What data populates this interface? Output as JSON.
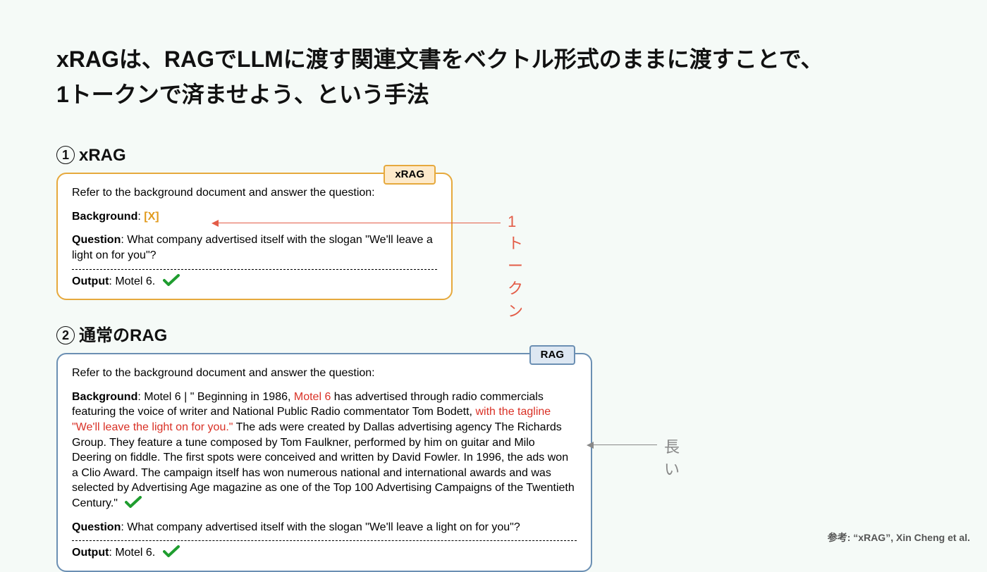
{
  "title_line1": "xRAGは、RAGでLLMに渡す関連文書をベクトル形式のままに渡すことで、",
  "title_line2": "1トークンで済ませよう、という手法",
  "section1": {
    "num": "1",
    "heading": "xRAG",
    "badge": "xRAG",
    "prompt": "Refer to the background document and answer the question:",
    "bg_label": "Background",
    "bg_token": "[X]",
    "q_label": "Question",
    "q_text": ": What company advertised itself with the slogan \"We'll leave a light on for you\"?",
    "out_label": "Output",
    "out_text": ": Motel 6.",
    "annotation": "1トークン"
  },
  "section2": {
    "num": "2",
    "heading": "通常のRAG",
    "badge": "RAG",
    "prompt": "Refer to the background document and answer the question:",
    "bg_label": "Background",
    "bg_pre": ": Motel 6 | \" Beginning in 1986, ",
    "bg_hl1": "Motel 6",
    "bg_mid": " has advertised through radio commercials featuring the voice of writer and National Public Radio commentator Tom Bodett, ",
    "bg_hl2": "with the tagline \"We'll leave the light on for you.\"",
    "bg_post": " The ads were created by Dallas advertising agency The Richards Group. They feature a tune composed by Tom Faulkner, performed by him on guitar and Milo Deering on fiddle. The first spots were conceived and written by David Fowler. In 1996, the ads won a Clio Award. The campaign itself has won numerous national and international awards and was selected by Advertising Age magazine as one of the Top 100 Advertising Campaigns of the Twentieth Century.\"",
    "q_label": "Question",
    "q_text": ": What company advertised itself with the slogan \"We'll leave a light on for you\"?",
    "out_label": "Output",
    "out_text": ": Motel 6.",
    "annotation": "長い"
  },
  "footer": "参考: “xRAG”, Xin Cheng et al."
}
